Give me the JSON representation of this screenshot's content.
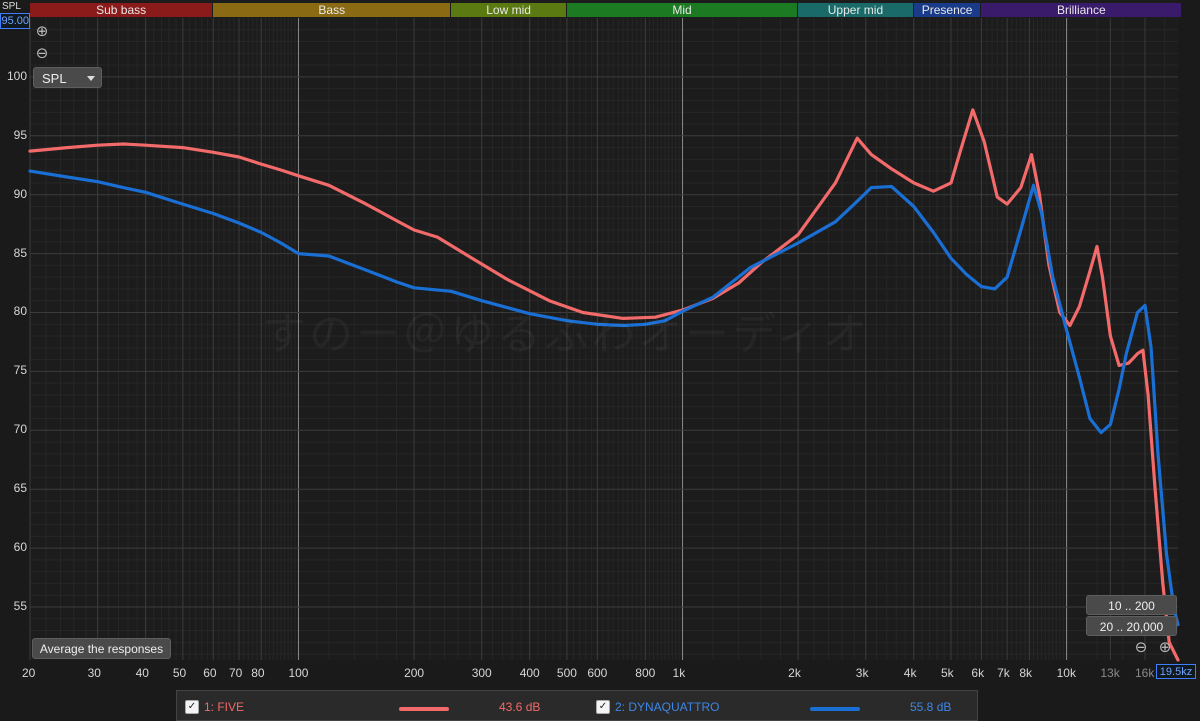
{
  "header": {
    "axis_corner_label": "SPL",
    "y_max_readout": "95.00"
  },
  "bands": [
    {
      "label": "Sub bass",
      "color": "#8b1a1a",
      "from": 20,
      "to": 60
    },
    {
      "label": "Bass",
      "color": "#8a6a12",
      "from": 60,
      "to": 250
    },
    {
      "label": "Low mid",
      "color": "#5b7a12",
      "from": 250,
      "to": 500
    },
    {
      "label": "Mid",
      "color": "#1c7a22",
      "from": 500,
      "to": 2000
    },
    {
      "label": "Upper mid",
      "color": "#1a6a6a",
      "from": 2000,
      "to": 4000
    },
    {
      "label": "Presence",
      "color": "#1a3a8a",
      "from": 4000,
      "to": 6000
    },
    {
      "label": "Brilliance",
      "color": "#3a1a6a",
      "from": 6000,
      "to": 20000
    }
  ],
  "controls": {
    "spl_select": "SPL",
    "average_button": "Average the responses",
    "range_buttons": [
      "10 .. 200",
      "20 .. 20,000"
    ],
    "x_max_readout": "19.5kz"
  },
  "watermark": "すのー＠ゆるふわオーディオ",
  "legend": [
    {
      "check": "✓",
      "name": "1: FIVE",
      "value": "43.6 dB",
      "color": "#f26a6a"
    },
    {
      "check": "✓",
      "name": "2: DYNAQUATTRO",
      "value": "55.8 dB",
      "color": "#1a6fd4"
    }
  ],
  "chart_data": {
    "type": "line",
    "xscale": "log",
    "xlim": [
      20,
      19500
    ],
    "ylim": [
      50.5,
      105
    ],
    "grid": true,
    "ylabel": "SPL",
    "x_ticks": [
      20,
      30,
      40,
      50,
      60,
      70,
      80,
      100,
      200,
      300,
      400,
      500,
      600,
      800,
      1000,
      2000,
      3000,
      4000,
      5000,
      6000,
      7000,
      8000,
      10000,
      13000,
      16000
    ],
    "x_tick_labels": [
      "20",
      "30",
      "40",
      "50",
      "60",
      "70",
      "80",
      "100",
      "200",
      "300",
      "400",
      "500",
      "600",
      "800",
      "1k",
      "2k",
      "3k",
      "4k",
      "5k",
      "6k",
      "7k",
      "8k",
      "10k",
      "13k",
      "16k"
    ],
    "y_ticks": [
      55,
      60,
      65,
      70,
      75,
      80,
      85,
      90,
      95,
      100
    ],
    "y_tick_labels": [
      "55",
      "60",
      "65",
      "70",
      "75",
      "80",
      "85",
      "90",
      "95",
      "100"
    ],
    "series": [
      {
        "name": "1: FIVE",
        "color": "#f26a6a",
        "points": [
          [
            20,
            93.7
          ],
          [
            25,
            94.0
          ],
          [
            30,
            94.2
          ],
          [
            35,
            94.3
          ],
          [
            40,
            94.2
          ],
          [
            50,
            94.0
          ],
          [
            60,
            93.6
          ],
          [
            70,
            93.2
          ],
          [
            80,
            92.6
          ],
          [
            90,
            92.1
          ],
          [
            100,
            91.6
          ],
          [
            120,
            90.8
          ],
          [
            150,
            89.2
          ],
          [
            180,
            87.8
          ],
          [
            200,
            87.0
          ],
          [
            230,
            86.4
          ],
          [
            280,
            84.7
          ],
          [
            350,
            82.8
          ],
          [
            450,
            81.0
          ],
          [
            550,
            80.0
          ],
          [
            700,
            79.5
          ],
          [
            850,
            79.6
          ],
          [
            1000,
            80.2
          ],
          [
            1200,
            81.2
          ],
          [
            1400,
            82.5
          ],
          [
            1600,
            84.2
          ],
          [
            2000,
            86.6
          ],
          [
            2500,
            91.0
          ],
          [
            2850,
            94.8
          ],
          [
            3100,
            93.4
          ],
          [
            3500,
            92.2
          ],
          [
            4000,
            91.0
          ],
          [
            4500,
            90.3
          ],
          [
            5000,
            91.0
          ],
          [
            5300,
            93.8
          ],
          [
            5700,
            97.2
          ],
          [
            6100,
            94.5
          ],
          [
            6600,
            89.8
          ],
          [
            7000,
            89.2
          ],
          [
            7600,
            90.6
          ],
          [
            8100,
            93.4
          ],
          [
            8500,
            90.0
          ],
          [
            9000,
            84.0
          ],
          [
            9600,
            80.0
          ],
          [
            10200,
            78.9
          ],
          [
            10800,
            80.5
          ],
          [
            11500,
            83.5
          ],
          [
            12000,
            85.6
          ],
          [
            12400,
            83.0
          ],
          [
            13000,
            78.0
          ],
          [
            13700,
            75.5
          ],
          [
            14500,
            75.7
          ],
          [
            15300,
            76.5
          ],
          [
            15800,
            76.8
          ],
          [
            16300,
            73.0
          ],
          [
            17000,
            65.0
          ],
          [
            17800,
            57.0
          ],
          [
            18500,
            52.0
          ],
          [
            19500,
            50.5
          ]
        ]
      },
      {
        "name": "2: DYNAQUATTRO",
        "color": "#1a6fd4",
        "points": [
          [
            20,
            92.0
          ],
          [
            25,
            91.5
          ],
          [
            30,
            91.1
          ],
          [
            35,
            90.6
          ],
          [
            40,
            90.2
          ],
          [
            50,
            89.2
          ],
          [
            60,
            88.4
          ],
          [
            70,
            87.6
          ],
          [
            80,
            86.8
          ],
          [
            90,
            85.9
          ],
          [
            100,
            85.0
          ],
          [
            120,
            84.8
          ],
          [
            150,
            83.6
          ],
          [
            180,
            82.6
          ],
          [
            200,
            82.1
          ],
          [
            250,
            81.8
          ],
          [
            300,
            81.0
          ],
          [
            400,
            79.9
          ],
          [
            500,
            79.3
          ],
          [
            600,
            79.0
          ],
          [
            700,
            78.9
          ],
          [
            800,
            79.0
          ],
          [
            900,
            79.3
          ],
          [
            1000,
            80.1
          ],
          [
            1200,
            81.3
          ],
          [
            1500,
            83.8
          ],
          [
            2000,
            85.9
          ],
          [
            2500,
            87.7
          ],
          [
            2800,
            89.2
          ],
          [
            3100,
            90.6
          ],
          [
            3500,
            90.7
          ],
          [
            4000,
            89.0
          ],
          [
            4500,
            86.8
          ],
          [
            5000,
            84.6
          ],
          [
            5500,
            83.2
          ],
          [
            6000,
            82.2
          ],
          [
            6500,
            82.0
          ],
          [
            7000,
            83.0
          ],
          [
            7600,
            87.0
          ],
          [
            8200,
            90.8
          ],
          [
            8600,
            88.5
          ],
          [
            9200,
            83.0
          ],
          [
            10000,
            78.5
          ],
          [
            10800,
            74.5
          ],
          [
            11500,
            71.0
          ],
          [
            12300,
            69.8
          ],
          [
            13000,
            70.5
          ],
          [
            13700,
            73.5
          ],
          [
            14300,
            76.5
          ],
          [
            15300,
            80.0
          ],
          [
            16000,
            80.6
          ],
          [
            16600,
            77.0
          ],
          [
            17300,
            68.0
          ],
          [
            18200,
            59.5
          ],
          [
            19000,
            55.0
          ],
          [
            19500,
            53.5
          ]
        ]
      }
    ]
  }
}
